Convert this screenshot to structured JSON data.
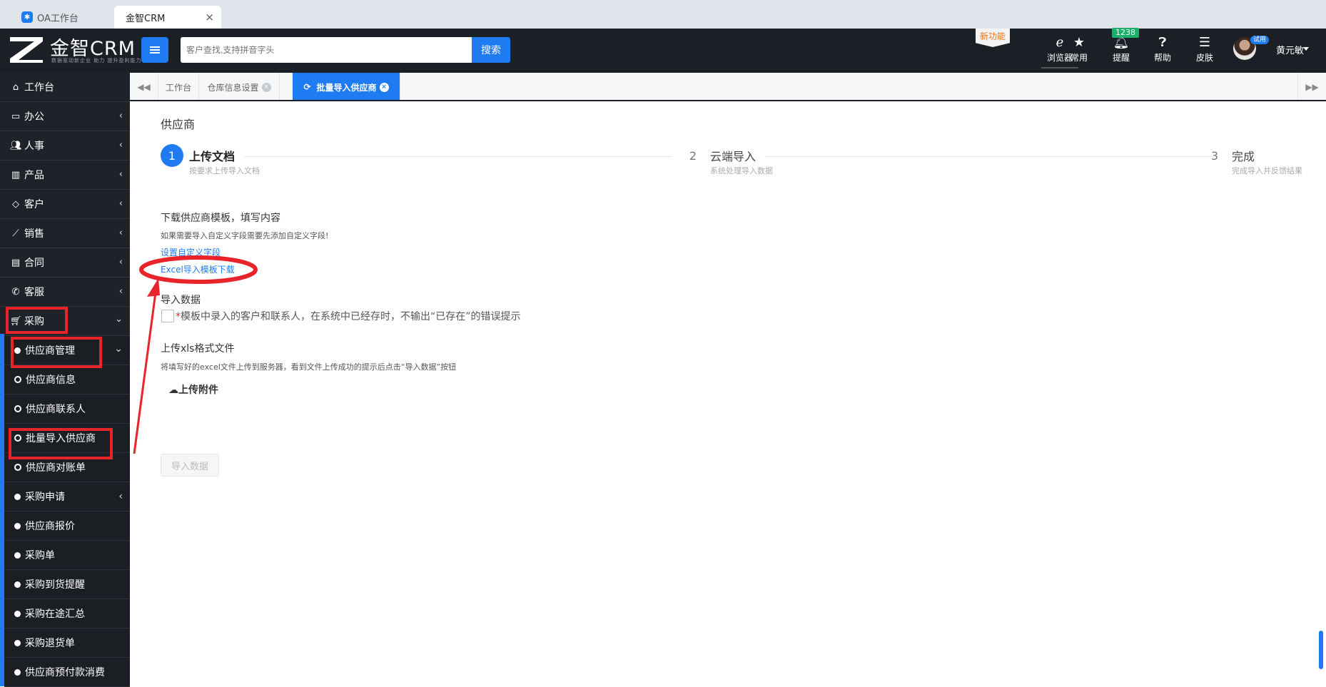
{
  "browser": {
    "tabs": [
      {
        "label": "OA工作台"
      },
      {
        "label": "金智CRM",
        "close": "×"
      }
    ]
  },
  "topbar": {
    "logo_text": "金智CRM",
    "logo_sub": "数据驱动新企业 助力 提升盈利能力",
    "search_placeholder": "客户查找,支持拼音字头",
    "search_label": "搜索",
    "new_feature": "新功能",
    "tools": [
      {
        "label": "浏览器",
        "icon": "ie-browser-icon"
      },
      {
        "label": "常用",
        "icon": "star-icon"
      },
      {
        "label": "提醒",
        "icon": "bell-icon",
        "badge": "1238"
      },
      {
        "label": "帮助",
        "icon": "help-icon"
      },
      {
        "label": "皮肤",
        "icon": "skin-icon"
      }
    ],
    "trial_badge": "试用",
    "user_name": "黄元敏"
  },
  "sidebar": {
    "items": [
      {
        "label": "工作台",
        "icon": "home-icon"
      },
      {
        "label": "办公",
        "icon": "laptop-icon"
      },
      {
        "label": "人事",
        "icon": "users-icon"
      },
      {
        "label": "产品",
        "icon": "barcode-icon"
      },
      {
        "label": "客户",
        "icon": "diamond-icon"
      },
      {
        "label": "销售",
        "icon": "chart-icon"
      },
      {
        "label": "合同",
        "icon": "contract-icon"
      },
      {
        "label": "客服",
        "icon": "phone-icon"
      },
      {
        "label": "采购",
        "icon": "cart-icon"
      }
    ],
    "subitems": [
      {
        "label": "供应商管理"
      },
      {
        "label": "供应商信息"
      },
      {
        "label": "供应商联系人"
      },
      {
        "label": "批量导入供应商"
      },
      {
        "label": "供应商对账单"
      },
      {
        "label": "采购申请"
      },
      {
        "label": "供应商报价"
      },
      {
        "label": "采购单"
      },
      {
        "label": "采购到货提醒"
      },
      {
        "label": "采购在途汇总"
      },
      {
        "label": "采购退货单"
      },
      {
        "label": "供应商预付款消费"
      }
    ]
  },
  "pagetabs": [
    {
      "label": "工作台"
    },
    {
      "label": "仓库信息设置",
      "close": "×"
    },
    {
      "label": "批量导入供应商",
      "close": "×",
      "active": true
    }
  ],
  "main": {
    "title": "供应商",
    "steps": [
      {
        "num": "1",
        "title": "上传文档",
        "desc": "按要求上传导入文档"
      },
      {
        "num": "2",
        "title": "云端导入",
        "desc": "系统处理导入数据"
      },
      {
        "num": "3",
        "title": "完成",
        "desc": "完成导入并反馈结果"
      }
    ],
    "download_title": "下载供应商模板，填写内容",
    "download_hint": "如果需要导入自定义字段需要先添加自定义字段!",
    "custom_field_link": "设置自定义字段",
    "excel_link": "Excel导入模板下载",
    "import_title": "导入数据",
    "checkbox_required_mark": "*",
    "checkbox_label": "模板中录入的客户和联系人，在系统中已经存时，不输出“已存在”的错误提示",
    "upload_title": "上传xls格式文件",
    "upload_hint": "将填写好的excel文件上传到服务器，看到文件上传成功的提示后点击“导入数据”按钮",
    "upload_button": "上传附件",
    "import_button": "导入数据"
  },
  "colors": {
    "accent": "#1e7bf2",
    "annotation_red": "#e8242a",
    "sidebar_bg": "#1f2329",
    "topbar_bg": "#1b1f26"
  }
}
